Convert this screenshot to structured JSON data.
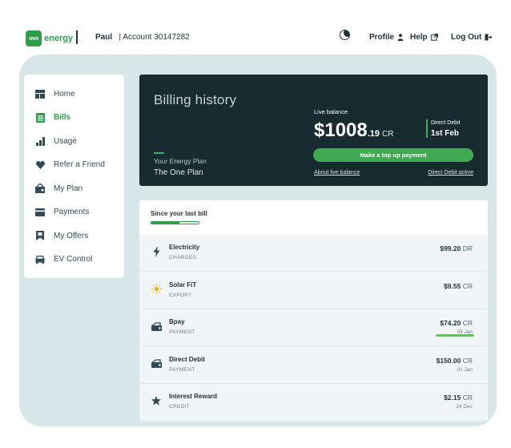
{
  "header": {
    "logo_badge": "ovo",
    "logo_text": "energy",
    "user_name": "Paul",
    "account": "| Account 30147282",
    "nav": {
      "profile": "Profile",
      "help": "Help",
      "logout": "Log Out"
    }
  },
  "sidebar": {
    "items": [
      {
        "label": "Home",
        "icon": "home-icon"
      },
      {
        "label": "Bills",
        "icon": "bills-icon",
        "active": true
      },
      {
        "label": "Usage",
        "icon": "usage-chart-icon"
      },
      {
        "label": "Refer a Friend",
        "icon": "heart-icon"
      },
      {
        "label": "My Plan",
        "icon": "plan-icon"
      },
      {
        "label": "Payments",
        "icon": "card-icon"
      },
      {
        "label": "My Offers",
        "icon": "bookmark-icon"
      },
      {
        "label": "EV Control",
        "icon": "car-icon"
      }
    ]
  },
  "hero": {
    "title": "Billing history",
    "plan_label": "Your Energy Plan",
    "plan_name": "The One Plan",
    "live_balance_label": "Live balance",
    "balance_currency": "$",
    "balance_whole": "1008",
    "balance_decimal": ".19",
    "balance_suffix": "CR",
    "direct_debit_label": "Direct Debit",
    "direct_debit_date": "1st Feb",
    "topup_button": "Make a top up payment",
    "about_link": "About live balance",
    "dd_link": "Direct Debit active"
  },
  "transactions": {
    "since_label": "Since your last bill",
    "since_progress": 0.6,
    "rows": [
      {
        "name": "Electricity",
        "type": "CHARGES",
        "amount": "$99.20",
        "suffix": "DR",
        "date": "",
        "icon": "lightning-icon"
      },
      {
        "name": "Solar FiT",
        "type": "EXPORT",
        "amount": "$9.55",
        "suffix": "CR",
        "date": "",
        "icon": "sun-icon"
      },
      {
        "name": "Bpay",
        "type": "PAYMENT",
        "amount": "$74.20",
        "suffix": "CR",
        "date": "09 Jan",
        "icon": "payment-icon",
        "highlight": true
      },
      {
        "name": "Direct Debit",
        "type": "PAYMENT",
        "amount": "$150.00",
        "suffix": "CR",
        "date": "01 Jan",
        "icon": "payment-icon"
      },
      {
        "name": "Interest Reward",
        "type": "CREDIT",
        "amount": "$2.15",
        "suffix": "CR",
        "date": "24 Dec",
        "icon": "star-icon"
      }
    ]
  },
  "colors": {
    "brand_green": "#2e9d4a",
    "hero_bg": "#172b31",
    "panel_bg": "#d7e6e9",
    "highlight_bar": "#4cd338"
  }
}
